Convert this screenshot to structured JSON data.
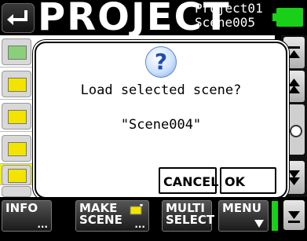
{
  "header": {
    "title": "PROJECT",
    "project_name": "Project01",
    "scene_name": "Scene005",
    "back_icon": "return-arrow-icon",
    "battery_color": "#18d018"
  },
  "dialog": {
    "icon": "question-icon",
    "message": "Load selected scene?",
    "scene": "\"Scene004\"",
    "cancel_label": "CANCEL",
    "ok_label": "OK"
  },
  "scrollbar": {
    "top_icon": "scroll-top-icon",
    "up_icon": "scroll-up-icon",
    "down_icon": "scroll-down-icon",
    "bottom_icon": "scroll-bottom-icon"
  },
  "footer": {
    "info_label": "INFO",
    "make_scene_label_1": "MAKE",
    "make_scene_label_2": "SCENE",
    "multi_select_label_1": "MULTI",
    "multi_select_label_2": "SELECT",
    "menu_label": "MENU",
    "ellipsis": "..."
  }
}
